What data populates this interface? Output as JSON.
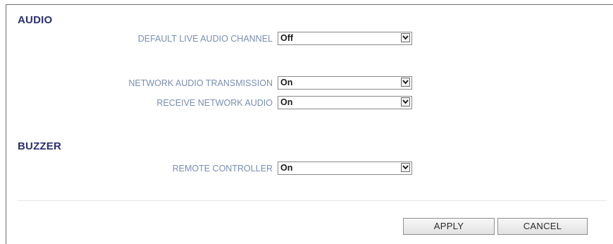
{
  "audio": {
    "title": "AUDIO",
    "default_live_audio_channel": {
      "label": "DEFAULT LIVE AUDIO CHANNEL",
      "value": "Off"
    },
    "network_audio_transmission": {
      "label": "NETWORK AUDIO TRANSMISSION",
      "value": "On"
    },
    "receive_network_audio": {
      "label": "RECEIVE NETWORK AUDIO",
      "value": "On"
    }
  },
  "buzzer": {
    "title": "BUZZER",
    "remote_controller": {
      "label": "REMOTE CONTROLLER",
      "value": "On"
    }
  },
  "buttons": {
    "apply": "APPLY",
    "cancel": "CANCEL"
  }
}
